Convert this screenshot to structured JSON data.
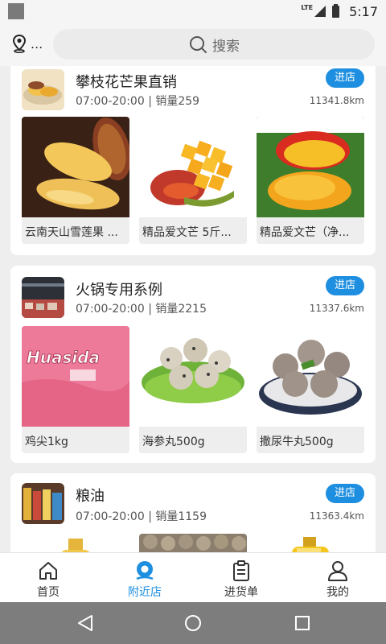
{
  "status_bar": {
    "network": "LTE",
    "time": "5:17"
  },
  "top_bar": {
    "location_text": "...",
    "search_placeholder": "搜索"
  },
  "shops": [
    {
      "name": "攀枝花芒果直销",
      "hours_sales": "07:00-20:00 | 销量259",
      "distance": "11341.8km",
      "enter_label": "进店",
      "products": [
        {
          "name": "云南天山雪莲果 ..."
        },
        {
          "name": "精品爱文芒 5斤..."
        },
        {
          "name": "精品爱文芒（净..."
        }
      ]
    },
    {
      "name": "火锅专用系例",
      "hours_sales": "07:00-20:00 | 销量2215",
      "distance": "11337.6km",
      "enter_label": "进店",
      "products": [
        {
          "name": "鸡尖1kg",
          "package_text": "Huasida"
        },
        {
          "name": "海参丸500g"
        },
        {
          "name": "撒尿牛丸500g"
        }
      ]
    },
    {
      "name": "粮油",
      "hours_sales": "07:00-20:00 | 销量1159",
      "distance": "11363.4km",
      "enter_label": "进店",
      "products": [
        {},
        {},
        {}
      ]
    }
  ],
  "bottom_nav": [
    {
      "label": "首页",
      "icon": "home-icon",
      "active": false
    },
    {
      "label": "附近店",
      "icon": "nearby-pin-icon",
      "active": true
    },
    {
      "label": "进货单",
      "icon": "clipboard-icon",
      "active": false
    },
    {
      "label": "我的",
      "icon": "user-icon",
      "active": false
    }
  ],
  "colors": {
    "accent": "#1e8fe0",
    "background": "#eeeeee",
    "card": "#ffffff"
  }
}
